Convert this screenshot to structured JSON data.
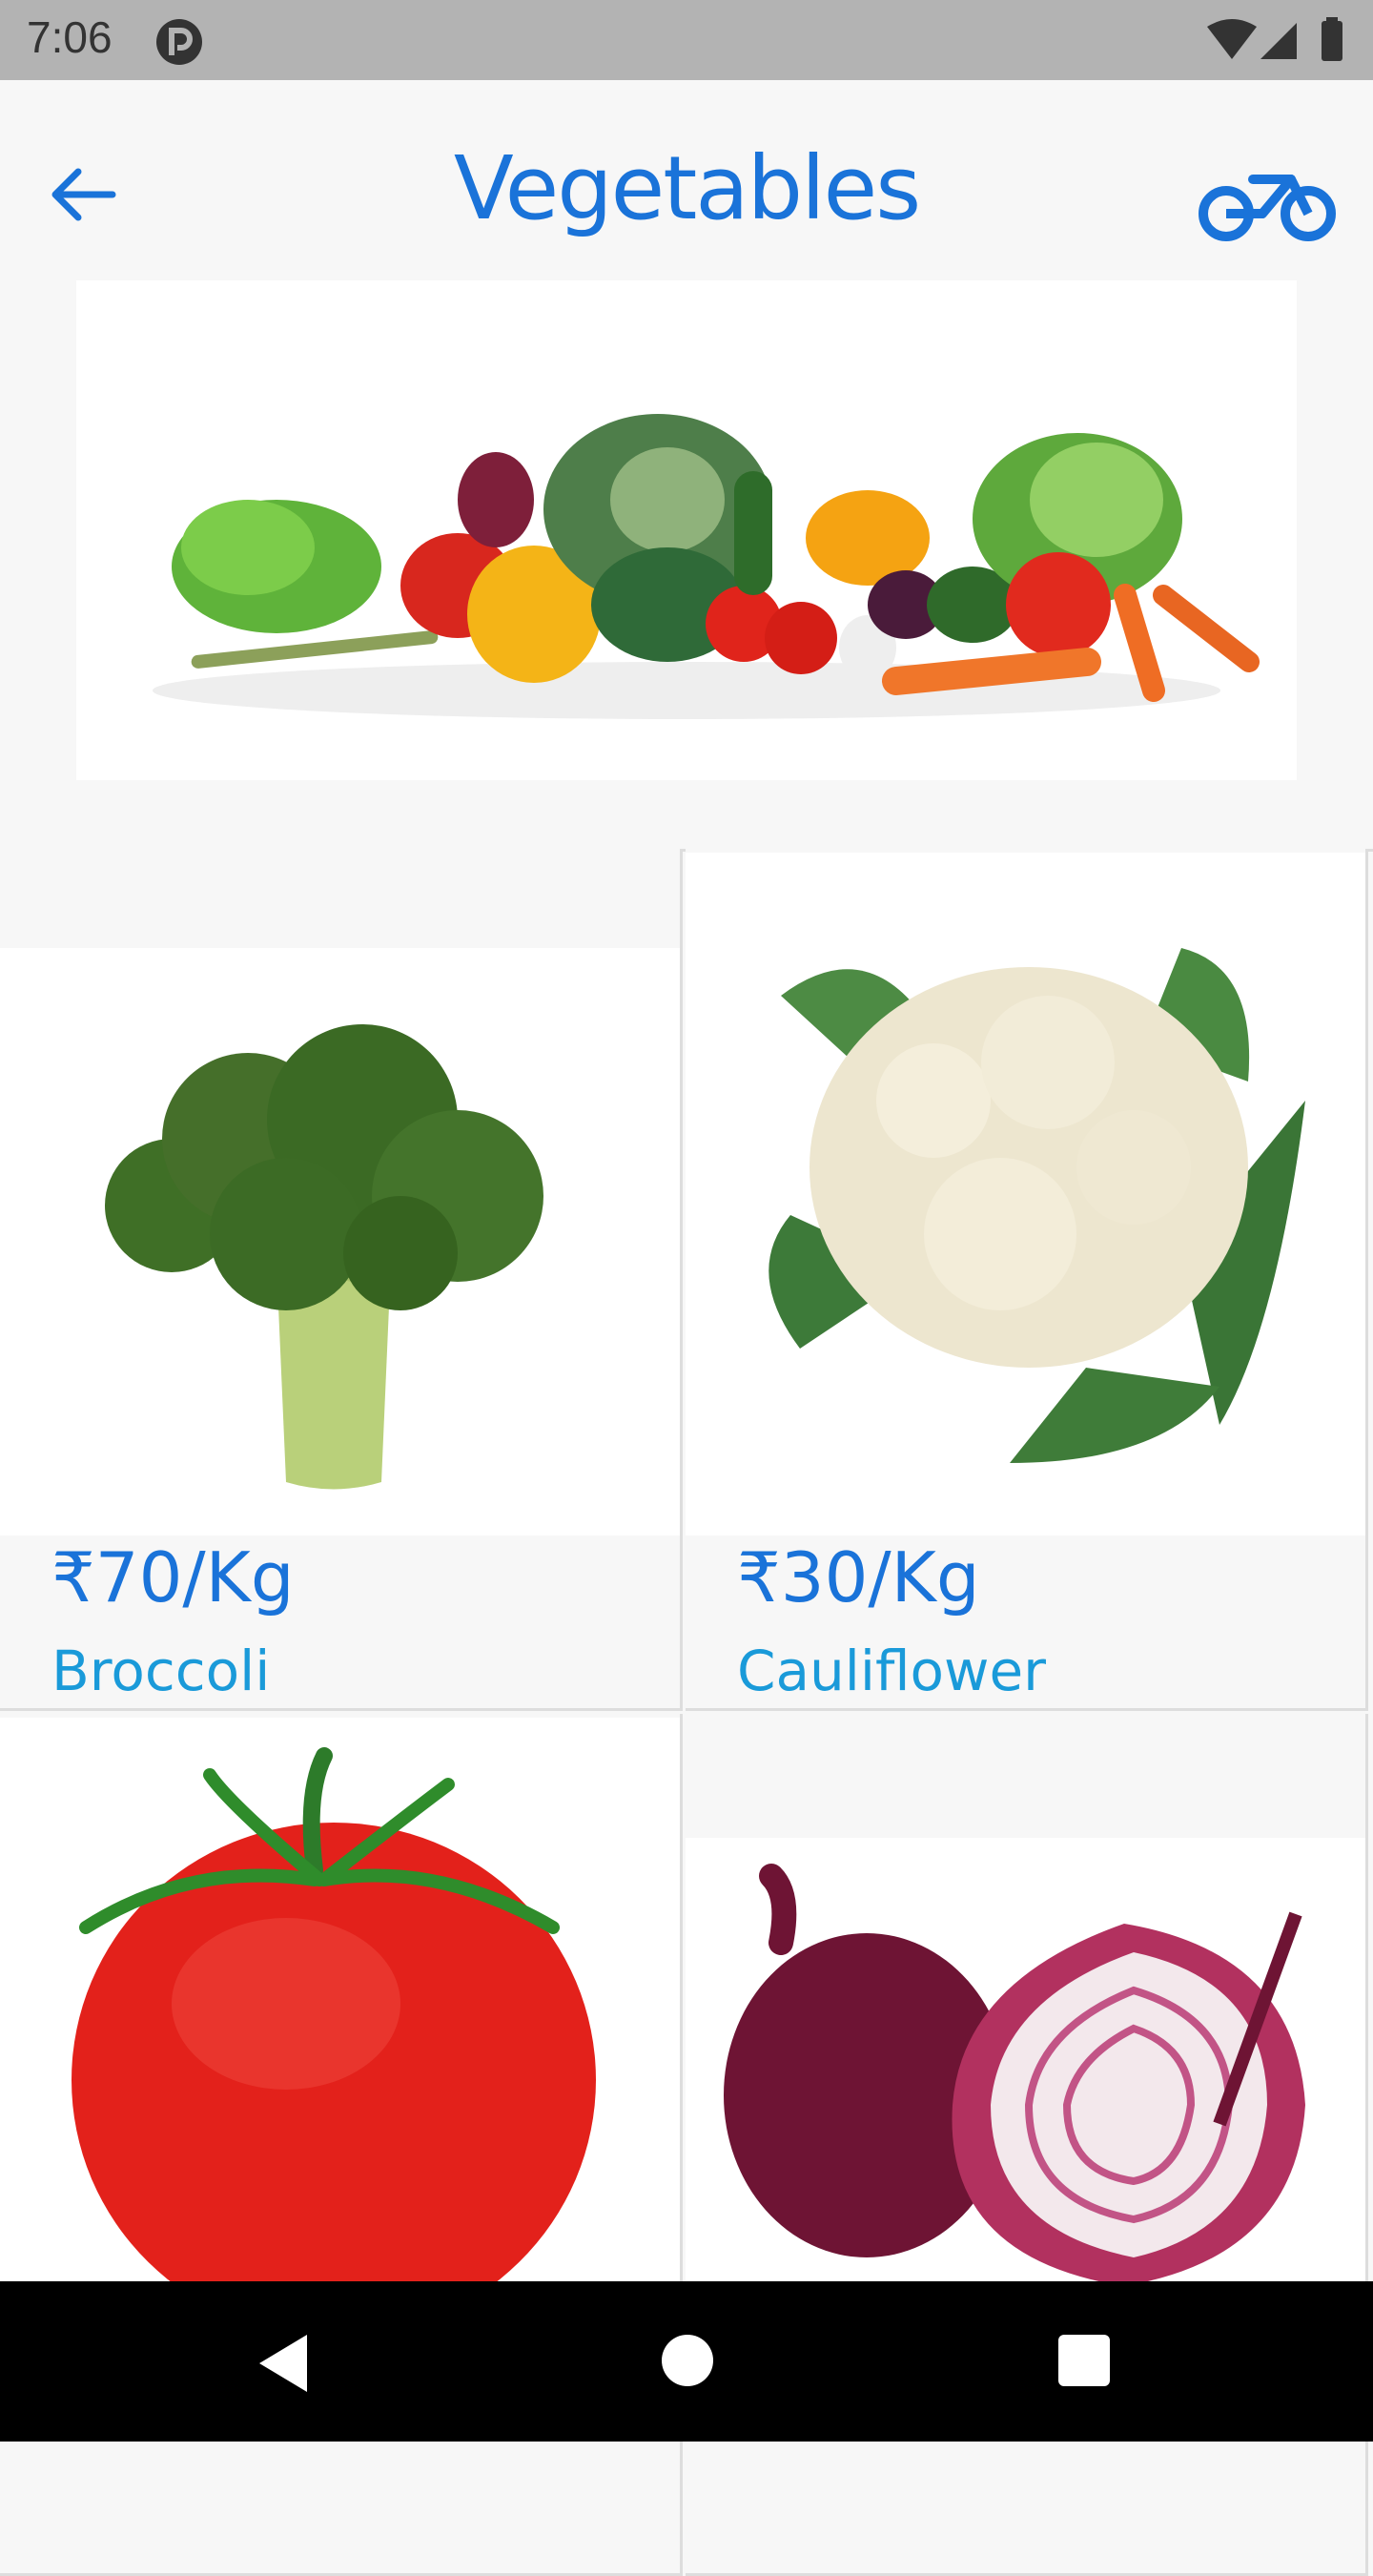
{
  "status_bar": {
    "time": "7:06"
  },
  "app_bar": {
    "title": "Vegetables"
  },
  "products": [
    {
      "price": "₹70/Kg",
      "name": "Broccoli"
    },
    {
      "price": "₹30/Kg",
      "name": "Cauliflower"
    },
    {
      "price": "",
      "name": ""
    },
    {
      "price": "",
      "name": ""
    }
  ],
  "colors": {
    "accent": "#1a73d9",
    "name_text": "#1a9ad9"
  },
  "icons": [
    "back-arrow-icon",
    "bike-icon",
    "wifi-icon",
    "signal-icon",
    "battery-icon",
    "app-p-icon"
  ]
}
